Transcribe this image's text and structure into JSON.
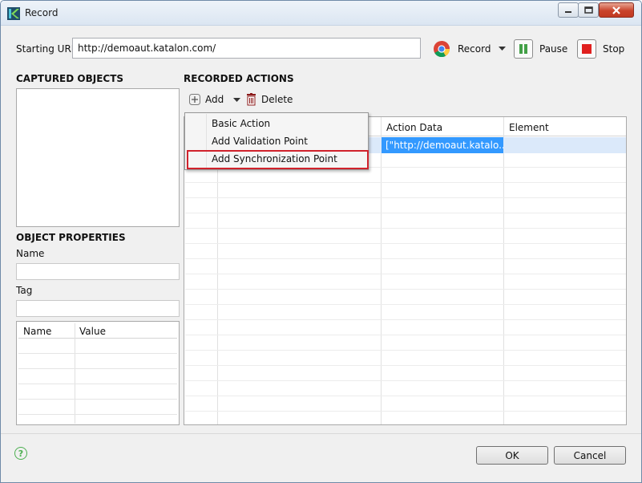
{
  "window": {
    "title": "Record"
  },
  "url_bar": {
    "label": "Starting URL",
    "value": "http://demoaut.katalon.com/"
  },
  "toolbar": {
    "record_label": "Record",
    "pause_label": "Pause",
    "stop_label": "Stop"
  },
  "captured_objects": {
    "title": "CAPTURED OBJECTS"
  },
  "object_properties": {
    "title": "OBJECT PROPERTIES",
    "name_label": "Name",
    "tag_label": "Tag",
    "table": {
      "columns": [
        "Name",
        "Value"
      ]
    }
  },
  "recorded_actions": {
    "title": "RECORDED ACTIONS",
    "add_label": "Add",
    "delete_label": "Delete",
    "columns": [
      "Action Data",
      "Element"
    ],
    "rows": [
      {
        "action_data": "[\"http://demoaut.katalo..."
      }
    ]
  },
  "add_menu": {
    "items": [
      "Basic Action",
      "Add Validation Point",
      "Add Synchronization Point"
    ]
  },
  "footer": {
    "ok_label": "OK",
    "cancel_label": "Cancel",
    "help_glyph": "?"
  }
}
